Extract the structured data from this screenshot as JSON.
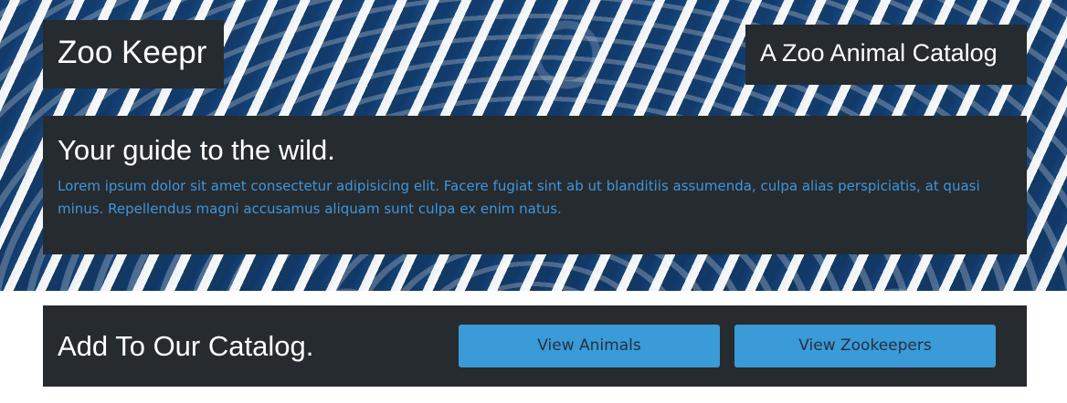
{
  "header": {
    "brand": "Zoo Keepr",
    "tagline": "A Zoo Animal Catalog"
  },
  "hero": {
    "heading": "Your guide to the wild.",
    "body": "Lorem ipsum dolor sit amet consectetur adipisicing elit. Facere fugiat sint ab ut blanditiis assumenda, culpa alias perspiciatis, at quasi minus. Repellendus magni accusamus aliquam sunt culpa ex enim natus."
  },
  "catalog": {
    "title": "Add To Our Catalog.",
    "buttons": [
      {
        "label": "View Animals"
      },
      {
        "label": "View Zookeepers"
      }
    ]
  },
  "theme": {
    "panel_color": "#262b2f",
    "accent_color": "#3b9ad8",
    "body_text_color": "#3f95dd",
    "button_text_color": "#23313d"
  }
}
